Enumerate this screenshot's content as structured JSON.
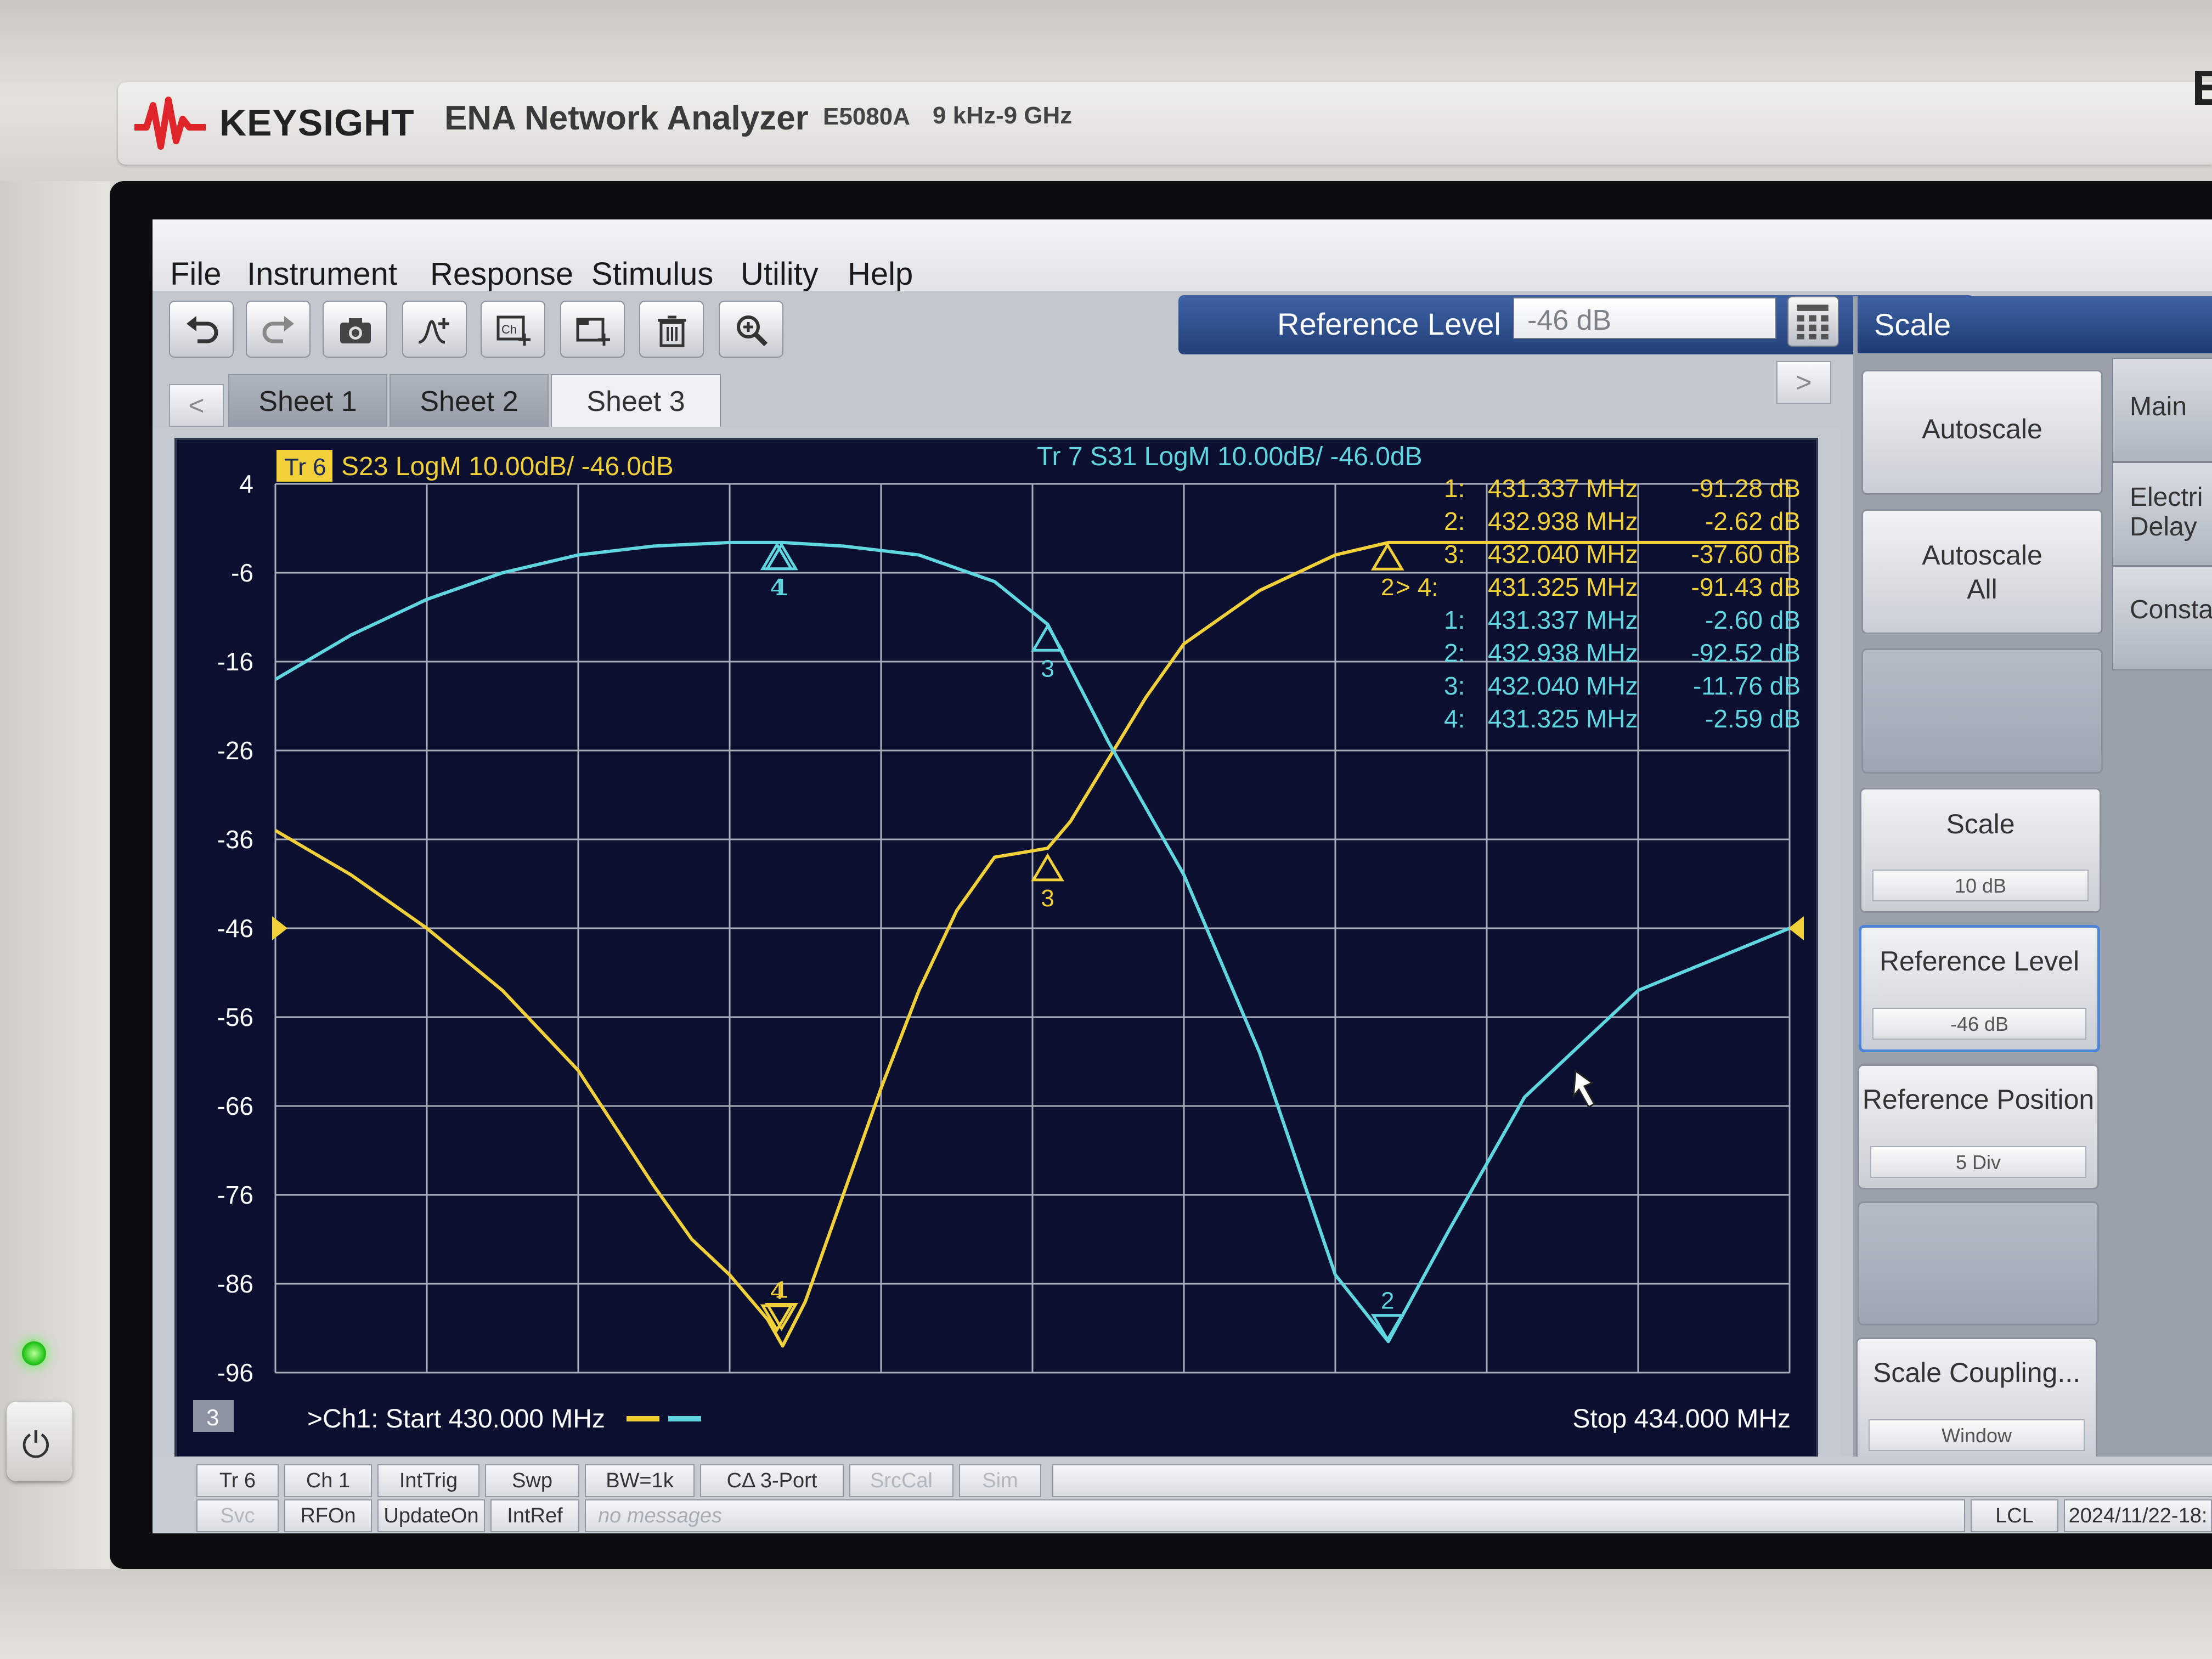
{
  "device": {
    "brand": "KEYSIGHT",
    "product": "ENA Network Analyzer",
    "model": "E5080A",
    "range": "9 kHz-9 GHz",
    "edge_letter": "E"
  },
  "menu": [
    "File",
    "Instrument",
    "Response",
    "Stimulus",
    "Utility",
    "Help"
  ],
  "toolbar": {
    "icons": [
      "undo-icon",
      "redo-icon",
      "camera-icon",
      "add-marker-icon",
      "add-trace-icon",
      "add-window-icon",
      "trash-icon",
      "zoom-icon"
    ]
  },
  "entry": {
    "label": "Reference Level",
    "value": "-46 dB",
    "calc_icon": "keypad-icon"
  },
  "sheets": {
    "prev": "<",
    "next": ">",
    "tabs": [
      {
        "label": "Sheet 1",
        "active": false
      },
      {
        "label": "Sheet 2",
        "active": false
      },
      {
        "label": "Sheet 3",
        "active": true
      }
    ]
  },
  "trace_headers": {
    "tr6_tag": "Tr 6",
    "tr6_text": "S23 LogM 10.00dB/ -46.0dB",
    "tr7_text": "Tr 7  S31 LogM 10.00dB/ -46.0dB"
  },
  "window_number": "3",
  "stimulus": {
    "start": ">Ch1:  Start  430.000 MHz",
    "stop": "Stop  434.000 MHz"
  },
  "marker_table": {
    "tr6": [
      {
        "num": "1:",
        "freq": "431.337  MHz",
        "val": "-91.28 dB"
      },
      {
        "num": "2:",
        "freq": "432.938  MHz",
        "val": "-2.62 dB"
      },
      {
        "num": "3:",
        "freq": "432.040  MHz",
        "val": "-37.60 dB"
      },
      {
        "num": "> 4:",
        "freq": "431.325  MHz",
        "val": "-91.43 dB"
      }
    ],
    "tr7": [
      {
        "num": "1:",
        "freq": "431.337  MHz",
        "val": "-2.60 dB"
      },
      {
        "num": "2:",
        "freq": "432.938  MHz",
        "val": "-92.52 dB"
      },
      {
        "num": "3:",
        "freq": "432.040  MHz",
        "val": "-11.76 dB"
      },
      {
        "num": "4:",
        "freq": "431.325  MHz",
        "val": "-2.59 dB"
      }
    ]
  },
  "chart_data": {
    "type": "line",
    "xlabel": "",
    "ylabel": "",
    "xlim": [
      430.0,
      434.0
    ],
    "ylim": [
      -96,
      4
    ],
    "y_ticks": [
      4,
      -6,
      -16,
      -26,
      -36,
      -46,
      -56,
      -66,
      -76,
      -86,
      -96
    ],
    "reference_level": -46,
    "grid": true,
    "colors": {
      "S23": "#f2d03a",
      "S31": "#5fd6e0",
      "background": "#0b0f30",
      "grid": "#a8adbb"
    },
    "series": [
      {
        "name": "S23",
        "x": [
          430.0,
          430.2,
          430.4,
          430.6,
          430.8,
          431.0,
          431.1,
          431.2,
          431.3,
          431.34,
          431.4,
          431.5,
          431.6,
          431.7,
          431.8,
          431.9,
          432.04,
          432.1,
          432.2,
          432.3,
          432.4,
          432.6,
          432.8,
          432.94,
          433.2,
          433.6,
          434.0
        ],
        "y": [
          -35,
          -40,
          -46,
          -53,
          -62,
          -75,
          -81,
          -85,
          -90,
          -93,
          -88,
          -76,
          -64,
          -53,
          -44,
          -38,
          -37,
          -34,
          -27,
          -20,
          -14,
          -8,
          -4,
          -2.6,
          -2.6,
          -2.6,
          -2.6
        ]
      },
      {
        "name": "S31",
        "x": [
          430.0,
          430.2,
          430.4,
          430.6,
          430.8,
          431.0,
          431.2,
          431.34,
          431.5,
          431.7,
          431.9,
          432.04,
          432.2,
          432.4,
          432.6,
          432.8,
          432.94,
          433.1,
          433.3,
          433.6,
          434.0
        ],
        "y": [
          -18,
          -13,
          -9,
          -6,
          -4,
          -3,
          -2.6,
          -2.6,
          -3,
          -4,
          -7,
          -11.8,
          -25,
          -40,
          -60,
          -85,
          -92.5,
          -80,
          -65,
          -53,
          -46
        ]
      }
    ],
    "markers": [
      {
        "series": "S23",
        "label": "1",
        "x": 431.337,
        "y": -91.28
      },
      {
        "series": "S23",
        "label": "2",
        "x": 432.938,
        "y": -2.62
      },
      {
        "series": "S23",
        "label": "3",
        "x": 432.04,
        "y": -37.6
      },
      {
        "series": "S23",
        "label": "4",
        "x": 431.325,
        "y": -91.43
      },
      {
        "series": "S31",
        "label": "1",
        "x": 431.337,
        "y": -2.6
      },
      {
        "series": "S31",
        "label": "2",
        "x": 432.938,
        "y": -92.52
      },
      {
        "series": "S31",
        "label": "3",
        "x": 432.04,
        "y": -11.76
      },
      {
        "series": "S31",
        "label": "4",
        "x": 431.325,
        "y": -2.59
      }
    ]
  },
  "panel": {
    "title": "Scale",
    "softkeys": [
      {
        "label": "Autoscale",
        "sub": ""
      },
      {
        "label": "Autoscale\nAll",
        "sub": ""
      },
      {
        "label": "",
        "sub": ""
      },
      {
        "label": "Scale",
        "sub": "10 dB"
      },
      {
        "label": "Reference Level",
        "sub": "-46 dB"
      },
      {
        "label": "Reference Position",
        "sub": "5 Div"
      },
      {
        "label": "",
        "sub": ""
      },
      {
        "label": "Scale Coupling...",
        "sub": "Window"
      }
    ],
    "side_tabs": [
      "Main",
      "Electri\nDelay",
      "Consta"
    ]
  },
  "status": {
    "row1": [
      "Tr 6",
      "Ch 1",
      "IntTrig",
      "Swp",
      "BW=1k",
      "CΔ 3-Port",
      "SrcCal",
      "Sim"
    ],
    "row2": [
      "Svc",
      "RFOn",
      "UpdateOn",
      "IntRef"
    ],
    "message": "no messages",
    "lcl": "LCL",
    "datetime": "2024/11/22-18:"
  }
}
